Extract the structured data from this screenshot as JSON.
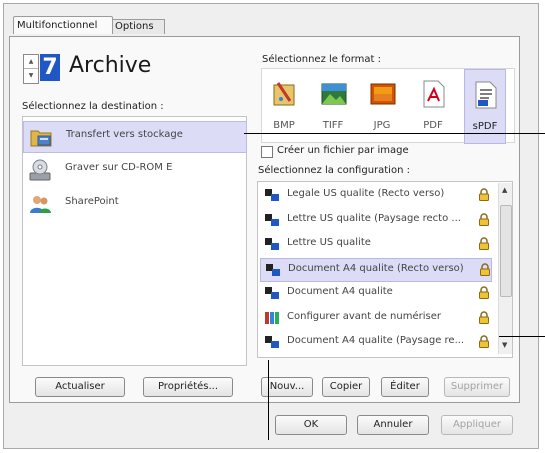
{
  "tabs": [
    {
      "label": "Multifonctionnel"
    },
    {
      "label": "Options"
    }
  ],
  "header": {
    "title": "Archive"
  },
  "destination": {
    "label": "Sélectionnez la destination :",
    "items": [
      {
        "label": "Transfert vers stockage",
        "icon": "folder-storage-icon",
        "selected": true
      },
      {
        "label": "Graver sur CD-ROM  E",
        "icon": "cd-drive-icon",
        "selected": false
      },
      {
        "label": "SharePoint",
        "icon": "sharepoint-people-icon",
        "selected": false
      }
    ],
    "buttons": {
      "refresh": "Actualiser",
      "properties": "Propriétés..."
    }
  },
  "format": {
    "label": "Sélectionnez le format :",
    "items": [
      {
        "label": "BMP",
        "icon": "bmp-paint-icon",
        "selected": false
      },
      {
        "label": "TIFF",
        "icon": "tiff-image-icon",
        "selected": false
      },
      {
        "label": "JPG",
        "icon": "jpg-image-icon",
        "selected": false
      },
      {
        "label": "PDF",
        "icon": "pdf-document-icon",
        "selected": false
      },
      {
        "label": "sPDF",
        "icon": "spdf-document-icon",
        "selected": true
      }
    ],
    "checkbox_label": "Créer un fichier par image",
    "checkbox_checked": false
  },
  "configuration": {
    "label": "Sélectionnez la configuration :",
    "items": [
      {
        "label": "Legale US qualite (Recto verso)",
        "icon": "scan-config-icon",
        "locked": true,
        "selected": false
      },
      {
        "label": "Lettre US qualite (Paysage recto ...",
        "icon": "scan-config-icon",
        "locked": true,
        "selected": false
      },
      {
        "label": "Lettre US qualite",
        "icon": "scan-config-icon",
        "locked": true,
        "selected": false
      },
      {
        "label": "Document A4 qualite (Recto verso)",
        "icon": "scan-config-icon",
        "locked": true,
        "selected": true
      },
      {
        "label": "Document A4 qualite",
        "icon": "scan-config-icon",
        "locked": true,
        "selected": false
      },
      {
        "label": "Configurer avant de numériser",
        "icon": "configure-before-scan-icon",
        "locked": true,
        "selected": false
      },
      {
        "label": "Document A4 qualite (Paysage re...",
        "icon": "scan-config-icon",
        "locked": true,
        "selected": false
      }
    ],
    "buttons": {
      "new": "Nouv...",
      "copy": "Copier",
      "edit": "Éditer",
      "delete": "Supprimer"
    }
  },
  "dialog_buttons": {
    "ok": "OK",
    "cancel": "Annuler",
    "apply": "Appliquer"
  },
  "colors": {
    "selection": "#dcdcf7",
    "accent_blue": "#1f58c4"
  }
}
